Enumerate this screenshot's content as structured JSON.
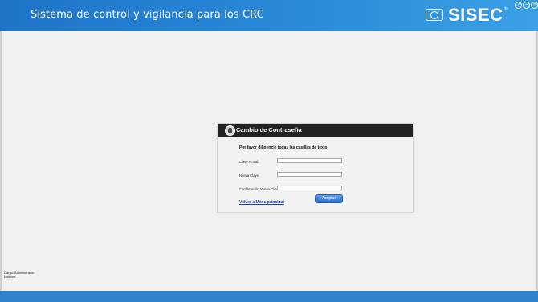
{
  "header": {
    "title": "Sistema de control y vigilancia para los CRC",
    "logo_text": "SISEC",
    "logo_reg": "®",
    "window_controls": [
      "?",
      "–",
      "×"
    ]
  },
  "dialog": {
    "title": "Cambio de Contraseña",
    "instructions": "Por favor diligencie todas las casillas de texto",
    "fields": [
      {
        "label": "Clave Actual:",
        "value": ""
      },
      {
        "label": "Nueva Clave:",
        "value": ""
      },
      {
        "label": "Confirmación Nueva Clave:",
        "value": ""
      }
    ],
    "accept_label": "Aceptar",
    "back_link": "Volver a Menu principal"
  },
  "user": {
    "cargo": "Cargo: Administrador",
    "nombre": "Nombre:"
  },
  "colors": {
    "header_blue": "#2a8ad8",
    "dialog_header": "#222222",
    "accent_button": "#2f6fcf",
    "footer_blue": "#2f83cc"
  }
}
